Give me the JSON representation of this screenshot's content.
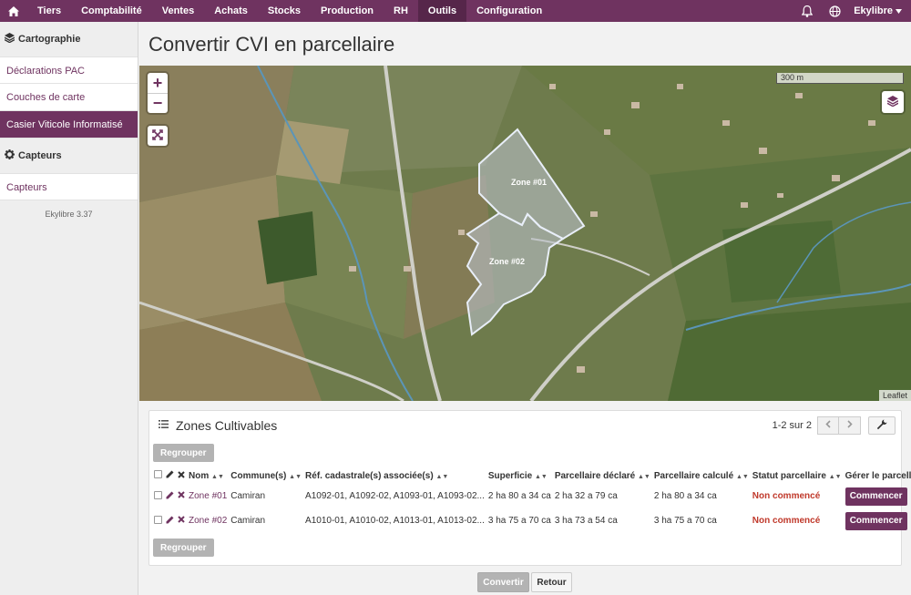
{
  "nav": {
    "items": [
      {
        "label": "Tiers"
      },
      {
        "label": "Comptabilité"
      },
      {
        "label": "Ventes"
      },
      {
        "label": "Achats"
      },
      {
        "label": "Stocks"
      },
      {
        "label": "Production"
      },
      {
        "label": "RH"
      },
      {
        "label": "Outils"
      },
      {
        "label": "Configuration"
      }
    ],
    "active": "Outils",
    "user": "Ekylibre",
    "accent": "#6f3360"
  },
  "sidebar": {
    "sections": [
      {
        "title": "Cartographie",
        "icon": "layers-icon",
        "items": [
          {
            "label": "Déclarations PAC"
          },
          {
            "label": "Couches de carte"
          },
          {
            "label": "Casier Viticole Informatisé"
          }
        ]
      },
      {
        "title": "Capteurs",
        "icon": "gear-icon",
        "items": [
          {
            "label": "Capteurs"
          }
        ]
      }
    ],
    "active_item": "Casier Viticole Informatisé",
    "version": "Ekylibre 3.37"
  },
  "page": {
    "title": "Convertir CVI en parcellaire"
  },
  "map": {
    "scale_label": "300 m",
    "attribution": "Leaflet",
    "zones": [
      {
        "label": "Zone #01"
      },
      {
        "label": "Zone #02"
      }
    ]
  },
  "panel": {
    "title": "Zones Cultivables",
    "pagination": "1-2 sur 2",
    "regroup_label": "Regrouper",
    "columns": [
      "Nom",
      "Commune(s)",
      "Réf. cadastrale(s) associée(s)",
      "Superficie",
      "Parcellaire déclaré",
      "Parcellaire calculé",
      "Statut parcellaire",
      "Gérer le parcellaire"
    ],
    "rows": [
      {
        "name": "Zone #01",
        "commune": "Camiran",
        "refs": "A1092-01, A1092-02, A1093-01, A1093-02...",
        "area": "2 ha 80 a 34 ca",
        "declared": "2 ha 32 a 79 ca",
        "computed": "2 ha 80 a 34 ca",
        "status": "Non commencé",
        "action": "Commencer"
      },
      {
        "name": "Zone #02",
        "commune": "Camiran",
        "refs": "A1010-01, A1010-02, A1013-01, A1013-02...",
        "area": "3 ha 75 a 70 ca",
        "declared": "3 ha 73 a 54 ca",
        "computed": "3 ha 75 a 70 ca",
        "status": "Non commencé",
        "action": "Commencer"
      }
    ]
  },
  "footer": {
    "convert_label": "Convertir",
    "back_label": "Retour"
  }
}
